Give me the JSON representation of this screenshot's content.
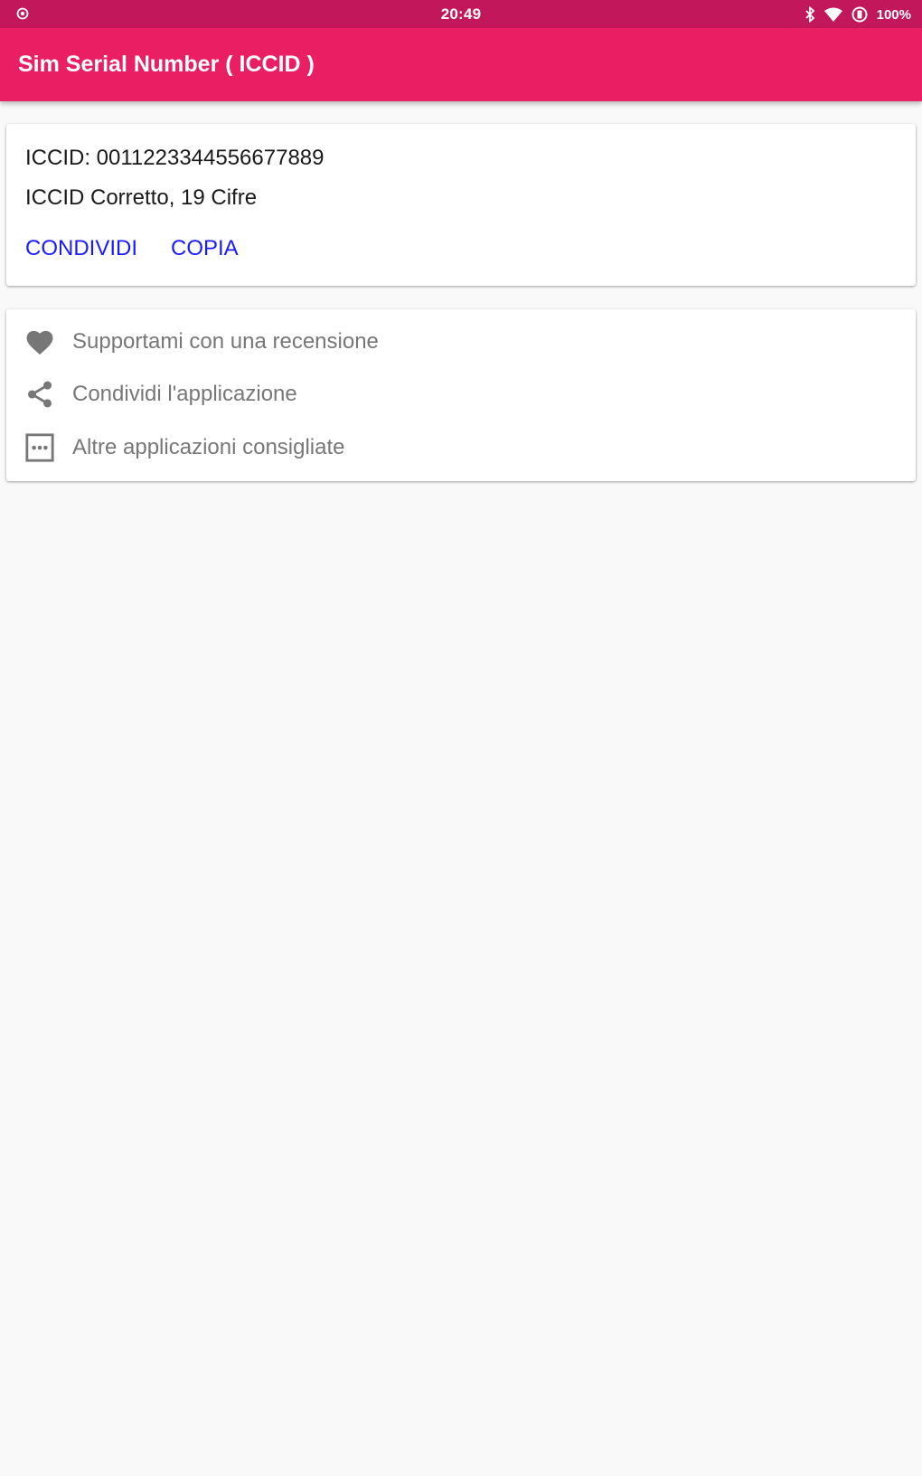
{
  "status_bar": {
    "time": "20:49",
    "battery": "100%",
    "icons": [
      "notification-dot-icon",
      "bluetooth-icon",
      "wifi-icon",
      "data-saver-icon"
    ]
  },
  "app_bar": {
    "title": "Sim Serial Number ( ICCID )",
    "color": "#e91e63",
    "status_color": "#c2185b"
  },
  "iccid_card": {
    "iccid": "ICCID: 0011223344556677889",
    "status": "ICCID Corretto, 19 Cifre",
    "share_label": "CONDIVIDI",
    "copy_label": "COPIA",
    "button_color": "#1a1aff"
  },
  "links_card": {
    "items": [
      {
        "icon": "heart-icon",
        "label": "Supportami con una recensione"
      },
      {
        "icon": "share-icon",
        "label": "Condividi l'applicazione"
      },
      {
        "icon": "more-apps-icon",
        "label": "Altre applicazioni consigliate"
      }
    ]
  }
}
